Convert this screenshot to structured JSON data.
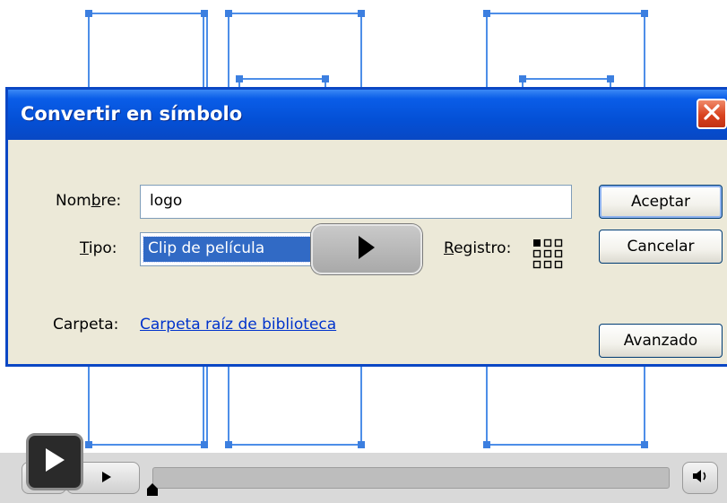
{
  "dialog": {
    "title": "Convertir en símbolo",
    "name_label_pre": "Nom",
    "name_label_u": "b",
    "name_label_post": "re:",
    "name_value": "logo",
    "type_label_u": "T",
    "type_label_post": "ipo:",
    "type_value": "Clip de película",
    "registration_label_u": "R",
    "registration_label_post": "egistro:",
    "folder_label": "Carpeta:",
    "folder_link": "Carpeta raíz de biblioteca",
    "ok_button": "Aceptar",
    "cancel_button": "Cancelar",
    "advanced_button": "Avanzado"
  },
  "icons": {
    "close": "close-icon",
    "play_overlay": "play-icon",
    "registration_grid": "registration-grid-icon",
    "player_play": "play-icon",
    "volume": "speaker-icon"
  },
  "colors": {
    "titlebar": "#0450d6",
    "dialog_bg": "#ece9d8",
    "selection_highlight": "#316ac5",
    "link": "#0033cc",
    "close_button": "#d9431f",
    "stage_selection": "#4d8ee8"
  }
}
